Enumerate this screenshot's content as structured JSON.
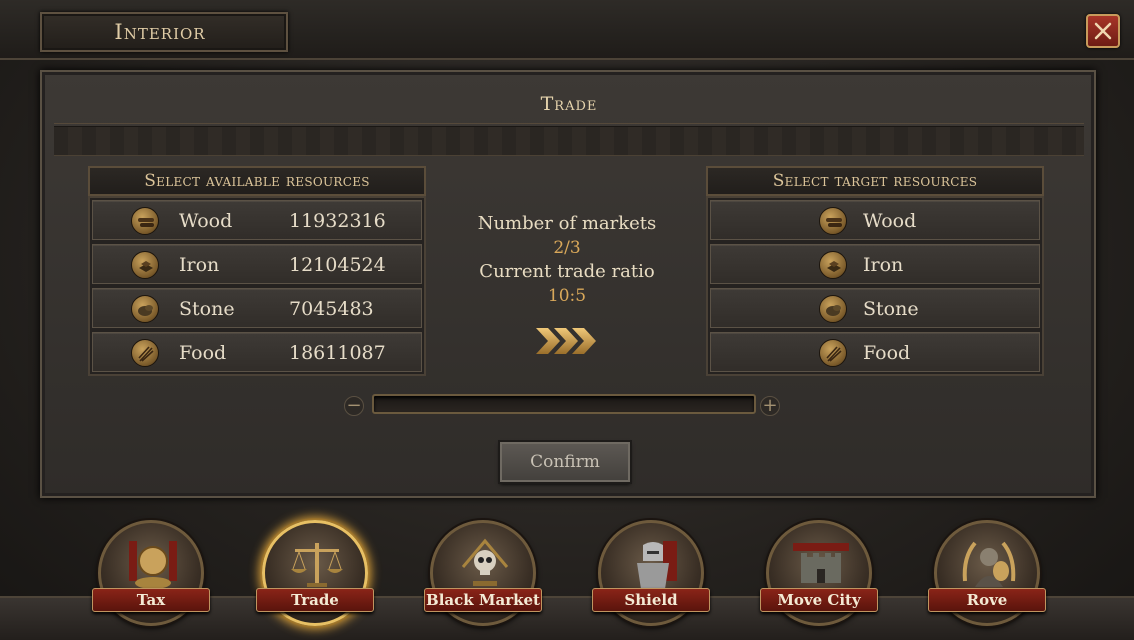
{
  "header": {
    "title": "Interior",
    "close_icon": "close-x-icon"
  },
  "panel": {
    "title": "Trade",
    "available_title": "Select available resources",
    "target_title": "Select target resources",
    "available": [
      {
        "name": "Wood",
        "amount": "11932316",
        "icon": "wood-icon"
      },
      {
        "name": "Iron",
        "amount": "12104524",
        "icon": "iron-icon"
      },
      {
        "name": "Stone",
        "amount": "7045483",
        "icon": "stone-icon"
      },
      {
        "name": "Food",
        "amount": "18611087",
        "icon": "food-icon"
      }
    ],
    "target": [
      {
        "name": "Wood",
        "icon": "wood-icon"
      },
      {
        "name": "Iron",
        "icon": "iron-icon"
      },
      {
        "name": "Stone",
        "icon": "stone-icon"
      },
      {
        "name": "Food",
        "icon": "food-icon"
      }
    ],
    "markets_label": "Number of markets",
    "markets_value": "2/3",
    "ratio_label": "Current trade ratio",
    "ratio_value": "10:5",
    "slider_value": 0,
    "minus_label": "−",
    "plus_label": "+",
    "confirm_label": "Confirm"
  },
  "nav": [
    {
      "label": "Tax",
      "icon": "tax-icon",
      "active": false
    },
    {
      "label": "Trade",
      "icon": "scales-icon",
      "active": true
    },
    {
      "label": "Black Market",
      "icon": "skull-icon",
      "active": false
    },
    {
      "label": "Shield",
      "icon": "knight-icon",
      "active": false
    },
    {
      "label": "Move City",
      "icon": "castle-icon",
      "active": false
    },
    {
      "label": "Rove",
      "icon": "rove-icon",
      "active": false
    }
  ],
  "colors": {
    "accent_gold": "#d9a85a",
    "ribbon_red": "#8a2418",
    "active_glow": "#e8c064"
  }
}
